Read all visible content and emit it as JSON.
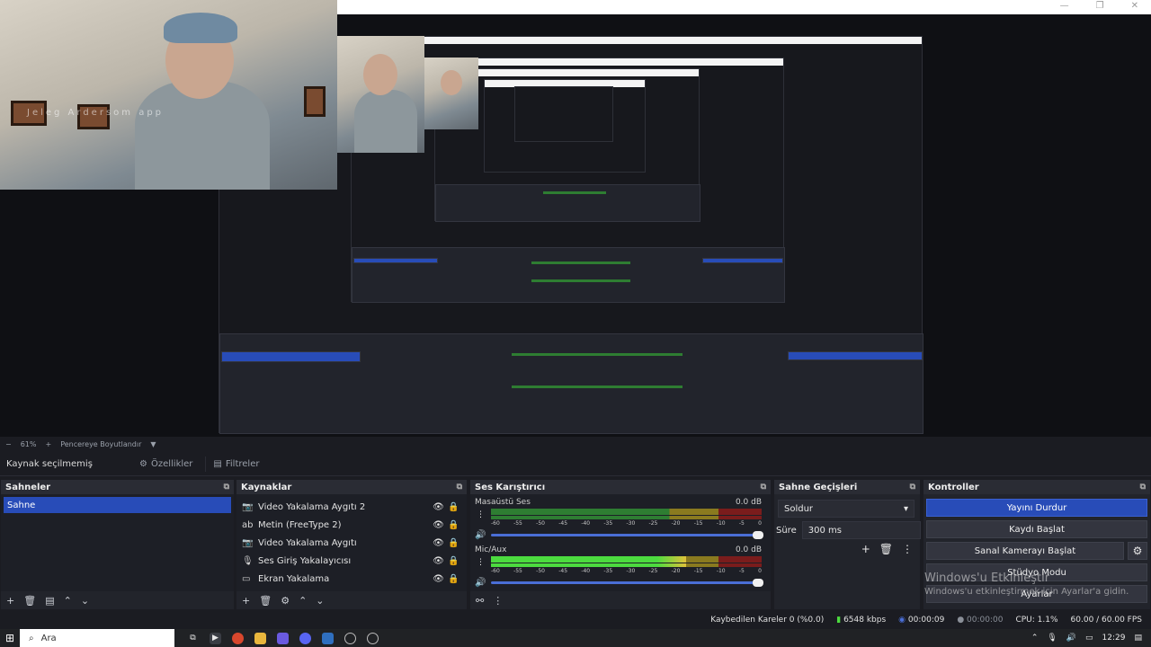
{
  "preview": {
    "watermark": "Jeleg Ardersom app"
  },
  "zoom": {
    "minus": "−",
    "value": "61%",
    "plus": "+",
    "fit_label": "Pencereye Boyutlandır",
    "menu_glyph": "▼"
  },
  "source_bar": {
    "no_source": "Kaynak seçilmemiş",
    "properties": "Özellikler",
    "filters": "Filtreler"
  },
  "scenes": {
    "title": "Sahneler",
    "items": [
      "Sahne"
    ]
  },
  "sources": {
    "title": "Kaynaklar",
    "items": [
      {
        "name": "Video Yakalama Aygıtı 2",
        "icon": "camera-icon"
      },
      {
        "name": "Metin (FreeType 2)",
        "icon": "text-icon"
      },
      {
        "name": "Video Yakalama Aygıtı",
        "icon": "camera-icon"
      },
      {
        "name": "Ses Giriş Yakalayıcısı",
        "icon": "mic-icon"
      },
      {
        "name": "Ekran Yakalama",
        "icon": "monitor-icon"
      }
    ]
  },
  "mixer": {
    "title": "Ses Karıştırıcı",
    "ticks": [
      "-60",
      "-55",
      "-50",
      "-45",
      "-40",
      "-35",
      "-30",
      "-25",
      "-20",
      "-15",
      "-10",
      "-5",
      "0"
    ],
    "channels": [
      {
        "name": "Masaüstü Ses",
        "db": "0.0 dB",
        "level": 0
      },
      {
        "name": "Mic/Aux",
        "db": "0.0 dB",
        "level": 0.72
      }
    ]
  },
  "transitions": {
    "title": "Sahne Geçişleri",
    "selected": "Soldur",
    "duration_label": "Süre",
    "duration_value": "300 ms"
  },
  "controls": {
    "title": "Kontroller",
    "stop_stream": "Yayını Durdur",
    "start_record": "Kaydı Başlat",
    "virtual_cam": "Sanal Kamerayı Başlat",
    "studio_mode": "Stüdyo Modu",
    "settings": "Ayarlar"
  },
  "activation": {
    "title": "Windows'u Etkinleştir",
    "subtitle": "Windows'u etkinleştirmek için Ayarlar'a gidin."
  },
  "status": {
    "dropped_frames": "Kaybedilen Kareler 0 (%0.0)",
    "bitrate": "6548 kbps",
    "stream_time": "00:00:09",
    "record_time": "00:00:00",
    "cpu": "CPU: 1.1%",
    "fps": "60.00 / 60.00 FPS"
  },
  "taskbar": {
    "search_placeholder": "Ara",
    "clock": "12:29"
  }
}
